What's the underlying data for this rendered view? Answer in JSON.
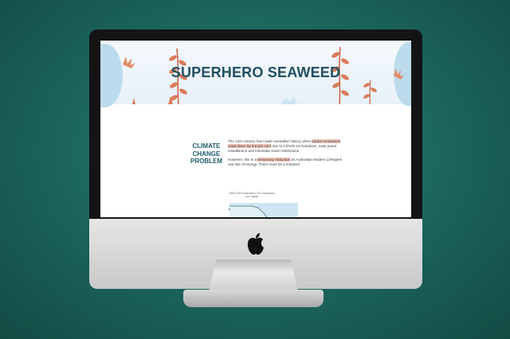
{
  "page": {
    "hero_title": "SUPERHERO SEAWEED",
    "section_title": "CLIMATE\nCHANGE\nPROBLEM",
    "para1": {
      "before": "The 21st century has made Australian history when ",
      "highlight1": "carbon emissions crept down by 6.6 per cent",
      "after": " due to COVID-19 lockdown, solar panel installations and interstate travel restrictions."
    },
    "para2": {
      "before": "However, this is a ",
      "highlight": "temporary reduction",
      "after": " as Australian Modern Lifestyles use lots of energy. There must be a solution!"
    },
    "chart_caption": "1990-2020 Australia's CO2 emissions per capita"
  },
  "colors": {
    "background": "#1d6a60",
    "hero_title": "#214f66",
    "seaweed": "#e07d5a",
    "highlight": "#f3c6b8",
    "chart_fill": "#cfe6f2"
  },
  "icons": [
    "apple-logo-icon"
  ]
}
